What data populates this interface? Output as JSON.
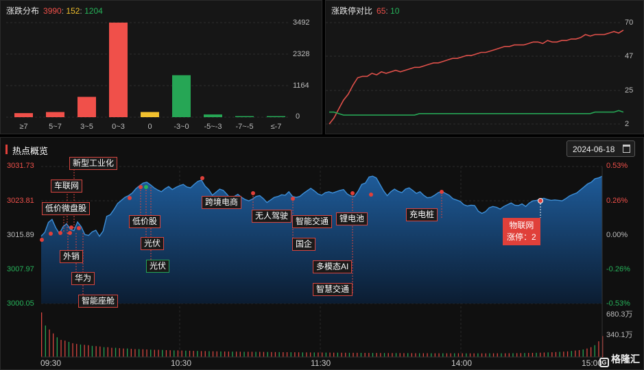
{
  "dist": {
    "title": "涨跌分布",
    "up": "3990",
    "flat": "152",
    "down": "1204",
    "yticks": [
      "3492",
      "2328",
      "1164",
      "0"
    ],
    "chart_data": {
      "type": "bar",
      "categories": [
        "≥7",
        "5~7",
        "3~5",
        "0~3",
        "0",
        "-3~0",
        "-5~-3",
        "-7~-5",
        "≤-7"
      ],
      "values": [
        150,
        190,
        750,
        3492,
        190,
        1550,
        100,
        15,
        10
      ],
      "colors": [
        "#f0504a",
        "#f0504a",
        "#f0504a",
        "#f0504a",
        "#f2c12e",
        "#26a655",
        "#26a655",
        "#26a655",
        "#26a655"
      ],
      "ylim": [
        0,
        3492
      ]
    }
  },
  "limit": {
    "title": "涨跌停对比",
    "up": "65",
    "down": "10",
    "yticks": [
      "70",
      "47",
      "25",
      "2"
    ],
    "chart_data": {
      "type": "line",
      "ylim": [
        2,
        70
      ],
      "series": [
        {
          "color": "#e0504a",
          "values": [
            2,
            6,
            12,
            18,
            22,
            28,
            33,
            34,
            34,
            36,
            35,
            37,
            36,
            37,
            38,
            37,
            38,
            39,
            40,
            40,
            41,
            42,
            43,
            43,
            44,
            45,
            46,
            46,
            47,
            48,
            48,
            49,
            50,
            50,
            51,
            52,
            53,
            54,
            54,
            55,
            55,
            55,
            56,
            57,
            57,
            56,
            58,
            57,
            57,
            58,
            58,
            59,
            59,
            60,
            62,
            61,
            62,
            62,
            62,
            63,
            64,
            63,
            65
          ]
        },
        {
          "color": "#26a655",
          "values": [
            10,
            10,
            9,
            8,
            8,
            8,
            8,
            8,
            8,
            8,
            8,
            8,
            8,
            8,
            8,
            8,
            8,
            8,
            8,
            9,
            9,
            9,
            9,
            9,
            9,
            9,
            9,
            9,
            9,
            9,
            9,
            9,
            9,
            9,
            9,
            9,
            9,
            9,
            9,
            9,
            9,
            9,
            9,
            9,
            9,
            9,
            9,
            9,
            9,
            9,
            9,
            9,
            9,
            9,
            9,
            9,
            10,
            10,
            10,
            10,
            10,
            11,
            10
          ]
        }
      ]
    }
  },
  "hot": {
    "title": "热点概览",
    "date": "2024-06-18",
    "calendar_icon": "calendar-icon",
    "left_ticks": [
      "3031.73",
      "3023.81",
      "3015.89",
      "3007.97",
      "3000.05"
    ],
    "right_ticks": [
      "0.53%",
      "0.26%",
      "0.00%",
      "-0.26%",
      "-0.53%"
    ],
    "vol_ticks": [
      "680.3万",
      "340.1万"
    ],
    "time_ticks": [
      "09:30",
      "10:30",
      "11:30",
      "14:00",
      "15:00"
    ],
    "tags": [
      "新型工业化",
      "车联网",
      "低价微盘股",
      "外销",
      "华为",
      "智能座舱",
      "低价股",
      "光伏",
      "光伏",
      "跨境电商",
      "无人驾驶",
      "智能交通",
      "国企",
      "多模态AI",
      "智慧交通",
      "锂电池",
      "充电桩"
    ],
    "highlight": "物联网\n涨停：2",
    "chart_data": {
      "type": "area",
      "ylim": [
        3000.05,
        3031.73
      ],
      "values": [
        3015.6,
        3016.5,
        3018.8,
        3019.5,
        3017.6,
        3016.2,
        3017.8,
        3018.5,
        3017.2,
        3016.9,
        3018.9,
        3017.8,
        3016.0,
        3015.8,
        3016.6,
        3017.0,
        3015.6,
        3016.8,
        3020.2,
        3020.6,
        3021.8,
        3023.2,
        3023.9,
        3024.6,
        3025.0,
        3025.6,
        3026.6,
        3027.3,
        3027.9,
        3028.1,
        3027.5,
        3026.8,
        3026.3,
        3025.9,
        3026.6,
        3027.1,
        3026.4,
        3026.9,
        3027.3,
        3027.6,
        3027.0,
        3026.8,
        3027.6,
        3028.3,
        3028.6,
        3027.2,
        3026.4,
        3025.1,
        3025.8,
        3026.5,
        3026.2,
        3025.3,
        3024.3,
        3024.8,
        3025.3,
        3024.6,
        3024.1,
        3023.8,
        3024.2,
        3024.8,
        3025.0,
        3024.3,
        3023.4,
        3024.0,
        3024.6,
        3024.8,
        3025.2,
        3025.1,
        3025.9,
        3024.8,
        3024.6,
        3024.8,
        3025.5,
        3026.1,
        3026.7,
        3026.1,
        3025.4,
        3025.1,
        3025.7,
        3025.9,
        3025.6,
        3025.9,
        3026.2,
        3026.4,
        3025.4,
        3024.9,
        3024.8,
        3026.0,
        3027.6,
        3027.9,
        3029.3,
        3029.5,
        3029.1,
        3027.6,
        3026.1,
        3025.0,
        3025.9,
        3026.5,
        3026.0,
        3025.7,
        3026.5,
        3026.8,
        3026.2,
        3025.5,
        3025.9,
        3025.1,
        3024.5,
        3024.6,
        3025.1,
        3025.7,
        3026.0,
        3025.5,
        3025.1,
        3024.3,
        3024.0,
        3023.7,
        3022.9,
        3022.6,
        3022.8,
        3022.7,
        3021.4,
        3020.9,
        3021.3,
        3022.2,
        3022.5,
        3022.3,
        3021.9,
        3022.5,
        3022.9,
        3023.3,
        3022.8,
        3022.7,
        3023.1,
        3022.5,
        3023.3,
        3023.8,
        3023.9,
        3024.2,
        3024.4,
        3024.1,
        3023.9,
        3024.0,
        3023.9,
        3023.8,
        3024.3,
        3024.9,
        3025.3,
        3025.6,
        3026.3,
        3027.0,
        3027.7,
        3028.1,
        3028.9,
        3029.1,
        3029.5
      ],
      "volume": [
        680,
        480,
        420,
        360,
        300,
        260,
        250,
        230,
        210,
        200,
        190,
        185,
        180,
        170,
        165,
        160,
        150,
        150,
        140,
        140,
        135,
        130,
        130,
        125,
        120,
        120,
        118,
        115,
        112,
        110,
        110,
        108,
        105,
        103,
        100,
        100,
        98,
        96,
        95,
        93,
        92,
        90,
        90,
        88,
        87,
        86,
        85,
        84,
        83,
        82,
        82,
        81,
        80,
        80,
        79,
        78,
        78,
        77,
        76,
        75,
        75,
        74,
        73,
        73,
        72,
        72,
        71,
        70,
        70,
        69,
        69,
        68,
        68,
        67,
        67,
        66,
        66,
        65,
        65,
        64,
        64,
        64,
        63,
        63,
        62,
        62,
        62,
        61,
        61,
        60,
        60,
        60,
        60,
        59,
        59,
        59,
        58,
        58,
        58,
        58,
        57,
        57,
        57,
        57,
        56,
        56,
        56,
        56,
        56,
        55,
        55,
        55,
        55,
        55,
        55,
        56,
        56,
        56,
        57,
        57,
        58,
        58,
        59,
        60,
        61,
        62,
        63,
        64,
        66,
        68,
        70,
        72,
        75,
        78,
        82,
        86,
        92,
        98,
        105,
        115,
        130,
        150,
        180,
        240,
        320
      ]
    }
  }
}
